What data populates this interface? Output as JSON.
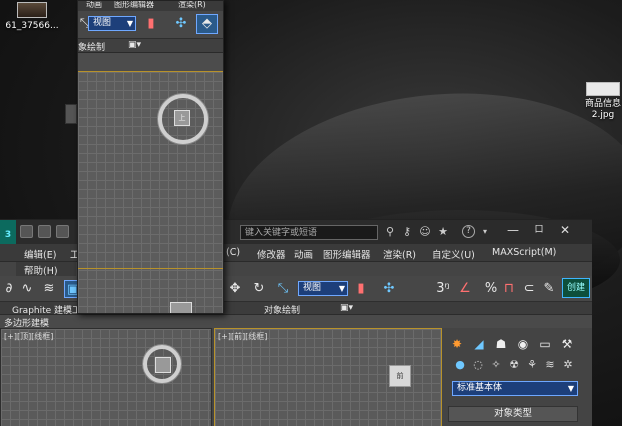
{
  "desktop": {
    "icon1_label": "61_37566...",
    "icon2_label": "商品信息\n2.jpg"
  },
  "titlebar": {
    "search_placeholder": "键入关键字或短语",
    "help_label": "?",
    "min_label": "—",
    "max_label": "口",
    "close_label": "✕"
  },
  "menu": {
    "items": [
      "编辑(E)",
      "工",
      "(C)",
      "修改器",
      "动画",
      "图形编辑器",
      "渲染(R)",
      "自定义(U)",
      "MAXScript(M)"
    ],
    "help_label": "帮助(H)"
  },
  "toolbar": {
    "view_dropdown": "视图",
    "snap_label": "3",
    "percent_snap_label": "%",
    "create_label": "创建",
    "tools": [
      "2↻",
      "⊕",
      "◯",
      "↗"
    ]
  },
  "ribbon": {
    "graphite_label": "Graphite 建模工",
    "object_paint_label": "对象绘制",
    "poly_label": "多边形建模"
  },
  "viewports": {
    "left_label": "[+][顶][线框]",
    "top_label": "[+][前][线框]",
    "viewcube_label": "前"
  },
  "command_panel": {
    "dropdown": "标准基本体",
    "rollout_label": "对象类型"
  },
  "float_window": {
    "menu_left": "动画",
    "menu_mid": "图形编辑器",
    "menu_right": "渲染(R)",
    "view_dropdown": "视图",
    "sub_label": "象绘制",
    "viewcube_label": "上"
  }
}
